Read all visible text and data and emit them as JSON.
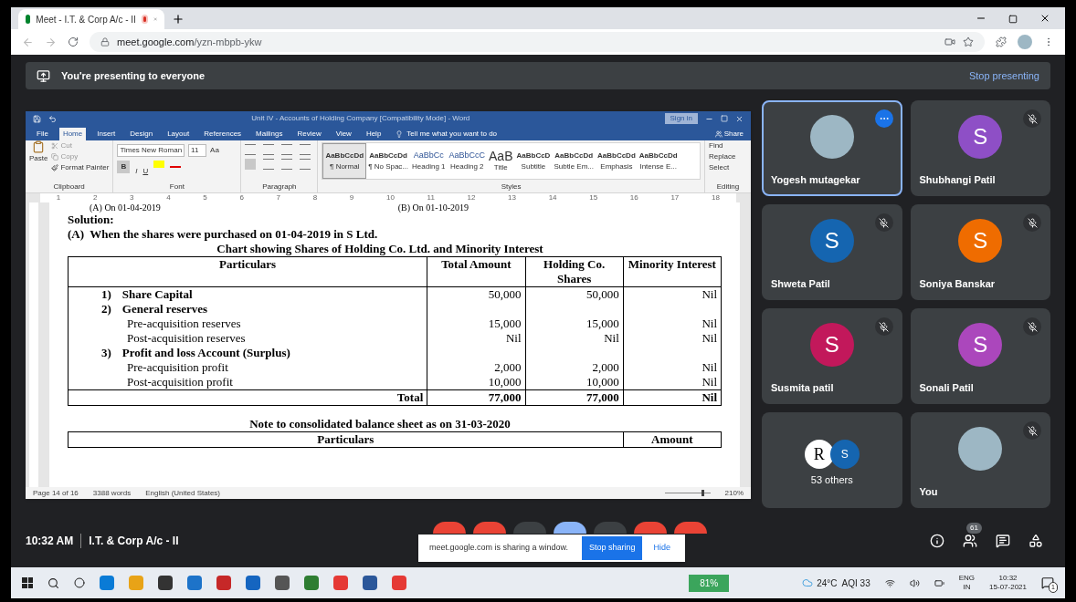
{
  "browser": {
    "tab": {
      "title": "Meet - I.T. & Corp A/c - II",
      "recording": true
    },
    "url_host": "meet.google.com",
    "url_path": "/yzn-mbpb-ykw"
  },
  "banner": {
    "text": "You're presenting to everyone",
    "action": "Stop presenting"
  },
  "word": {
    "title": "Unit IV - Accounts of Holding Company [Compatibility Mode]  -  Word",
    "sign_in": "Sign in",
    "tabs": [
      {
        "label": "File",
        "selected": false
      },
      {
        "label": "Home",
        "selected": true
      },
      {
        "label": "Insert",
        "selected": false
      },
      {
        "label": "Design",
        "selected": false
      },
      {
        "label": "Layout",
        "selected": false
      },
      {
        "label": "References",
        "selected": false
      },
      {
        "label": "Mailings",
        "selected": false
      },
      {
        "label": "Review",
        "selected": false
      },
      {
        "label": "View",
        "selected": false
      },
      {
        "label": "Help",
        "selected": false
      }
    ],
    "tell_me": "Tell me what you want to do",
    "share": "Share",
    "clipboard": {
      "paste": "Paste",
      "cut": "Cut",
      "copy": "Copy",
      "format_painter": "Format Painter"
    },
    "font_name": "Times New Roman",
    "font_size": "11",
    "change_case": "Aa",
    "font_buttons": [
      "B",
      "I",
      "U"
    ],
    "styles": [
      {
        "preview": "AaBbCcDd",
        "name": "¶ Normal",
        "selected": true
      },
      {
        "preview": "AaBbCcDd",
        "name": "¶ No Spac...",
        "selected": false
      },
      {
        "preview": "AaBbCc",
        "name": "Heading 1",
        "selected": false
      },
      {
        "preview": "AaBbCcC",
        "name": "Heading 2",
        "selected": false
      },
      {
        "preview": "AaB",
        "name": "Title",
        "selected": false
      },
      {
        "preview": "AaBbCcD",
        "name": "Subtitle",
        "selected": false
      },
      {
        "preview": "AaBbCcDd",
        "name": "Subtle Em...",
        "selected": false
      },
      {
        "preview": "AaBbCcDd",
        "name": "Emphasis",
        "selected": false
      },
      {
        "preview": "AaBbCcDd",
        "name": "Intense E...",
        "selected": false
      }
    ],
    "editing": [
      "Find",
      "Replace",
      "Select"
    ],
    "groups": [
      "Clipboard",
      "Font",
      "Paragraph",
      "Styles",
      "Editing"
    ],
    "ruler": [
      "1",
      "2",
      "3",
      "4",
      "5",
      "6",
      "7",
      "8",
      "9",
      "10",
      "11",
      "12",
      "13",
      "14",
      "15",
      "16",
      "17",
      "18"
    ],
    "status": {
      "page": "Page 14 of 16",
      "words": "3388 words",
      "language": "English (United States)",
      "zoom": "210%",
      "zoom_level": {
        "level": 0.8
      }
    }
  },
  "document": {
    "cut_lines": [
      "(A) On 01-04-2019",
      "(B) On 01-10-2019"
    ],
    "solution": "Solution:",
    "heading": "(A)  When the shares were purchased on 01-04-2019 in S Ltd.",
    "chart_title": "Chart showing Shares of Holding Co. Ltd. and Minority Interest",
    "columns": [
      "Particulars",
      "Total Amount",
      "Holding Co. Shares",
      "Minority Interest"
    ],
    "rows": [
      {
        "kind": "section",
        "number": "1)",
        "label": "Share Capital",
        "values": [
          "50,000",
          "50,000",
          "Nil"
        ]
      },
      {
        "kind": "section",
        "number": "2)",
        "label": "General reserves",
        "values": []
      },
      {
        "kind": "item",
        "label": "Pre-acquisition reserves",
        "values": [
          "15,000",
          "15,000",
          "Nil"
        ]
      },
      {
        "kind": "item",
        "label": "Post-acquisition reserves",
        "values": [
          "Nil",
          "Nil",
          "Nil"
        ]
      },
      {
        "kind": "section",
        "number": "3)",
        "label": "Profit and loss Account (Surplus)",
        "values": []
      },
      {
        "kind": "item",
        "label": "Pre-acquisition profit",
        "values": [
          "2,000",
          "2,000",
          "Nil"
        ]
      },
      {
        "kind": "item",
        "label": "Post-acquisition profit",
        "values": [
          "10,000",
          "10,000",
          "Nil"
        ]
      },
      {
        "kind": "total",
        "label": "Total",
        "values": [
          "77,000",
          "77,000",
          "Nil"
        ]
      }
    ],
    "note_title": "Note to consolidated balance sheet as on 31-03-2020",
    "note_columns": [
      "Particulars",
      "Amount"
    ]
  },
  "tiles": [
    {
      "kind": "photo",
      "name": "Yogesh mutagekar",
      "muted": false,
      "active": true
    },
    {
      "kind": "letter",
      "name": "Shubhangi Patil",
      "letter": "S",
      "color": "#8e4fc6",
      "muted": true,
      "active": false
    },
    {
      "kind": "letter",
      "name": "Shweta Patil",
      "letter": "S",
      "color": "#1565b0",
      "muted": true,
      "active": false
    },
    {
      "kind": "letter",
      "name": "Soniya Banskar",
      "letter": "S",
      "color": "#ef6c00",
      "muted": true,
      "active": false
    },
    {
      "kind": "letter",
      "name": "Susmita patil",
      "letter": "S",
      "color": "#c2185b",
      "muted": true,
      "active": false
    },
    {
      "kind": "letter",
      "name": "Sonali Patil",
      "letter": "S",
      "color": "#ab47bc",
      "muted": true,
      "active": false
    },
    {
      "kind": "others",
      "name": "53 others",
      "letters": [
        "R",
        "S"
      ],
      "muted": false,
      "active": false
    },
    {
      "kind": "photo",
      "name": "You",
      "muted": true,
      "active": false
    }
  ],
  "meet_bar": {
    "time": "10:32 AM",
    "meeting": "I.T. & Corp A/c - II",
    "people_count": "61"
  },
  "share_popup": {
    "text": "meet.google.com is sharing a window.",
    "stop": "Stop sharing",
    "hide": "Hide"
  },
  "taskbar": {
    "battery": "81%",
    "weather": "24°C  AQI 33",
    "lang": [
      "ENG",
      "IN"
    ],
    "time": "10:32",
    "date": "15-07-2021",
    "notifications": "1"
  }
}
